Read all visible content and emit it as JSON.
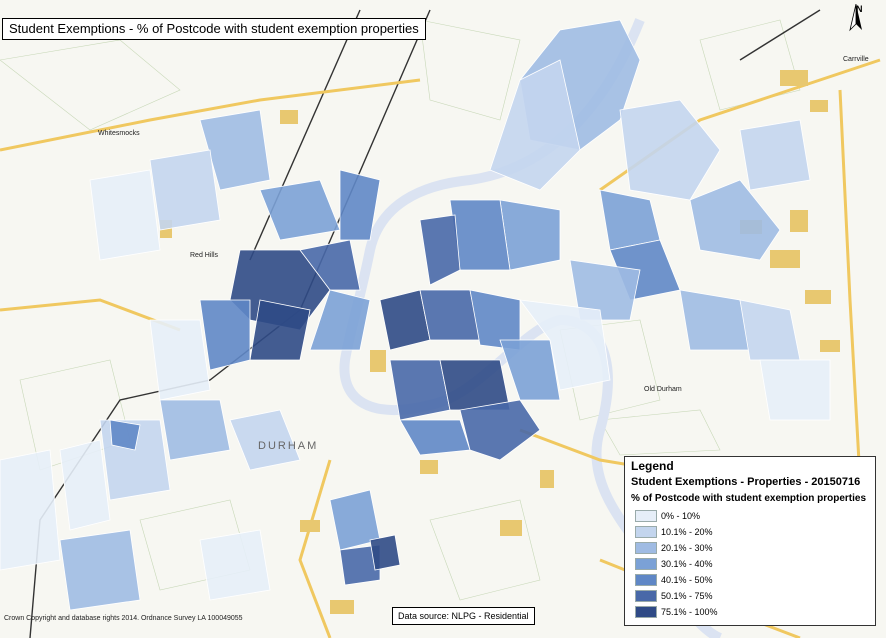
{
  "map": {
    "title": "Student Exemptions - % of Postcode with student exemption properties",
    "north_label": "N",
    "place_labels": [
      "Whitesmocks",
      "Red Hills",
      "DURHAM",
      "Carrville",
      "Old Durham"
    ],
    "river_color": "#dbe3f2",
    "road_color": "#f0c860",
    "building_color": "#e8c870"
  },
  "legend": {
    "title": "Legend",
    "layer": "Student Exemptions - Properties - 20150716",
    "field": "% of Postcode with student exemption properties",
    "classes": [
      {
        "label": "0% - 10%",
        "color": "#e6eef8"
      },
      {
        "label": "10.1% - 20%",
        "color": "#c3d5ee"
      },
      {
        "label": "20.1% - 30%",
        "color": "#9fbbe3"
      },
      {
        "label": "30.1% - 40%",
        "color": "#7ba1d6"
      },
      {
        "label": "40.1% - 50%",
        "color": "#5f87c6"
      },
      {
        "label": "50.1% - 75%",
        "color": "#4868a8"
      },
      {
        "label": "75.1% - 100%",
        "color": "#2f4a86"
      }
    ]
  },
  "footer": {
    "source": "Data source: NLPG - Residential",
    "copyright": "Crown Copyright and database rights 2014. Ordnance Survey LA 100049055"
  }
}
